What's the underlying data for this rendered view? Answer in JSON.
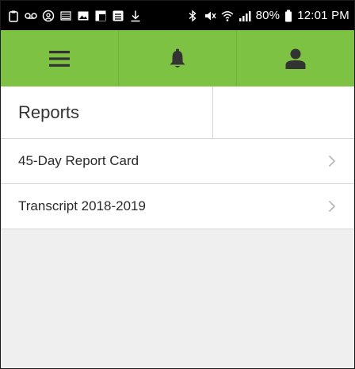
{
  "statusbar": {
    "battery": "80%",
    "time": "12:01 PM",
    "left_icons": [
      "clipboard-icon",
      "voicemail-icon",
      "at-icon",
      "sim-icon",
      "image-icon",
      "flipboard-icon",
      "drawer-icon",
      "download-icon"
    ],
    "right_icons": [
      "bluetooth-icon",
      "mute-icon",
      "wifi-icon",
      "signal-icon",
      "battery-icon"
    ]
  },
  "header": {
    "menu_icon": "menu-icon",
    "notifications_icon": "bell-icon",
    "profile_icon": "user-icon",
    "background_color": "#7dc242",
    "icon_color": "#333333"
  },
  "section": {
    "title": "Reports"
  },
  "reports": [
    {
      "label": "45-Day Report Card"
    },
    {
      "label": "Transcript 2018-2019"
    }
  ]
}
